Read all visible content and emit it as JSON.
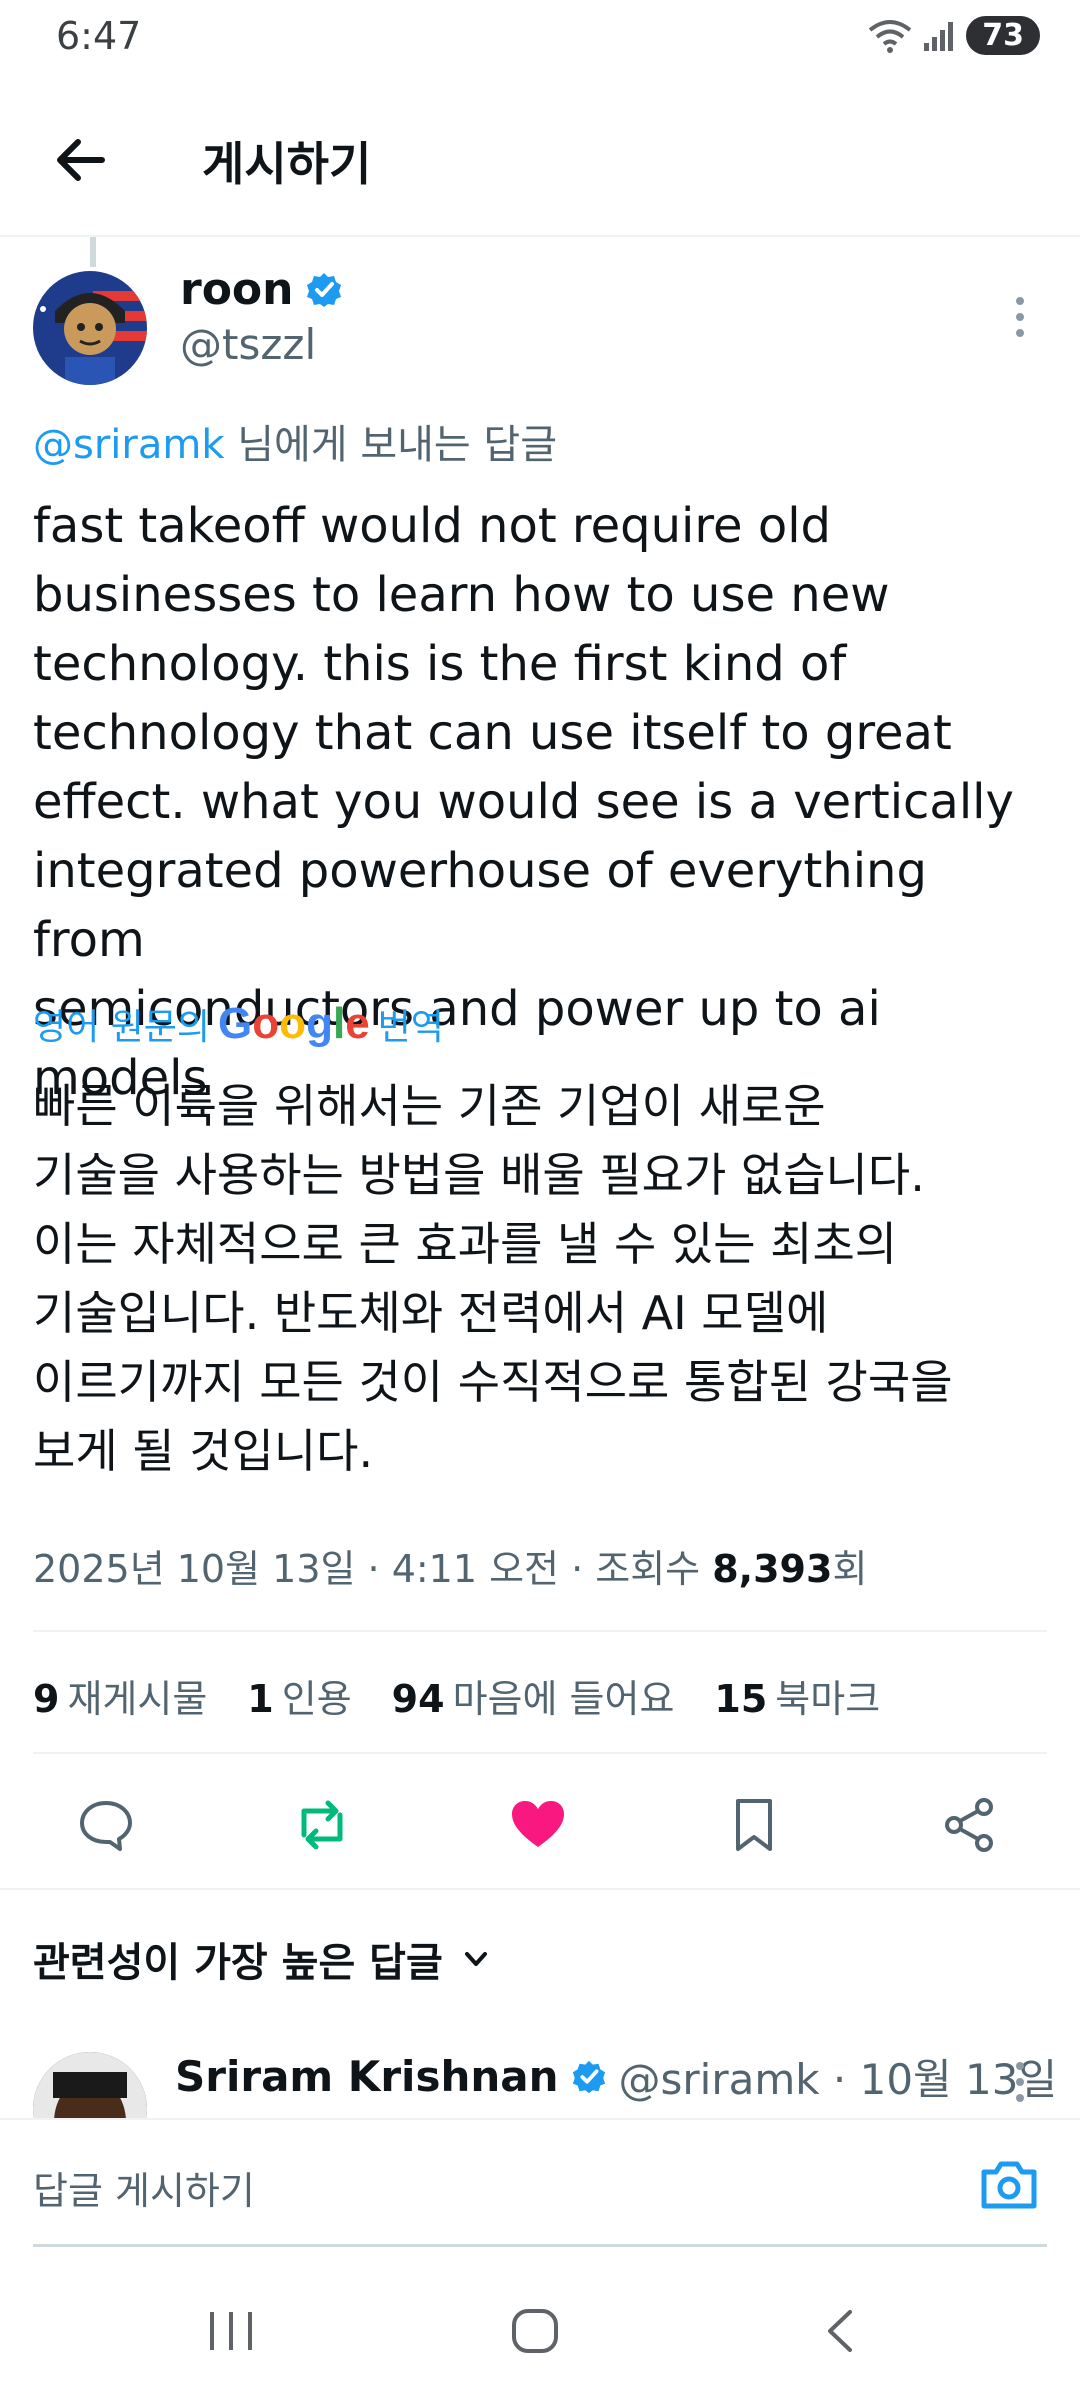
{
  "status_bar": {
    "time": "6:47",
    "battery": "73"
  },
  "header": {
    "title": "게시하기"
  },
  "tweet": {
    "author_name": "roon",
    "author_handle": "@tszzl",
    "reply_mention": "@sriramk",
    "reply_suffix": " 님에게 보내는 답글",
    "body": "fast takeoff would not require old\nbusinesses to learn how to use new\ntechnology. this is the first kind of\ntechnology that can use itself to great\neffect. what you would see is a vertically\nintegrated powerhouse of everything from\nsemiconductors and power up to ai models",
    "translate_prefix": "영어 원문의",
    "translate_brand": "Google",
    "translate_suffix": "번역",
    "translated_body": "빠른 이륙을 위해서는 기존 기업이 새로운\n기술을 사용하는 방법을 배울 필요가 없습니다.\n이는 자체적으로 큰 효과를 낼 수 있는 최초의\n기술입니다. 반도체와 전력에서 AI 모델에\n이르기까지 모든 것이 수직적으로 통합된 강국을\n보게 될 것입니다.",
    "timestamp": "2025년 10월 13일 · 4:11 오전 · 조회수 ",
    "views": "8,393",
    "views_suffix": "회"
  },
  "stats": [
    {
      "count": "9",
      "label": "재게시물"
    },
    {
      "count": "1",
      "label": "인용"
    },
    {
      "count": "94",
      "label": "마음에 들어요"
    },
    {
      "count": "15",
      "label": "북마크"
    }
  ],
  "actions": [
    {
      "icon": "reply-icon"
    },
    {
      "icon": "repost-icon",
      "color": "#00ba7c"
    },
    {
      "icon": "like-icon",
      "color": "#f91880"
    },
    {
      "icon": "bookmark-icon"
    },
    {
      "icon": "share-icon"
    }
  ],
  "replies_section": {
    "title": "관련성이 가장 높은 답글",
    "first_reply": {
      "author_name": "Sriram Krishnan",
      "author_handle": "@sriramk · 10월 13일"
    }
  },
  "composer": {
    "placeholder": "답글 게시하기"
  },
  "colors": {
    "accent": "#1d9bf0",
    "text": "#0f1419",
    "muted": "#536471"
  }
}
